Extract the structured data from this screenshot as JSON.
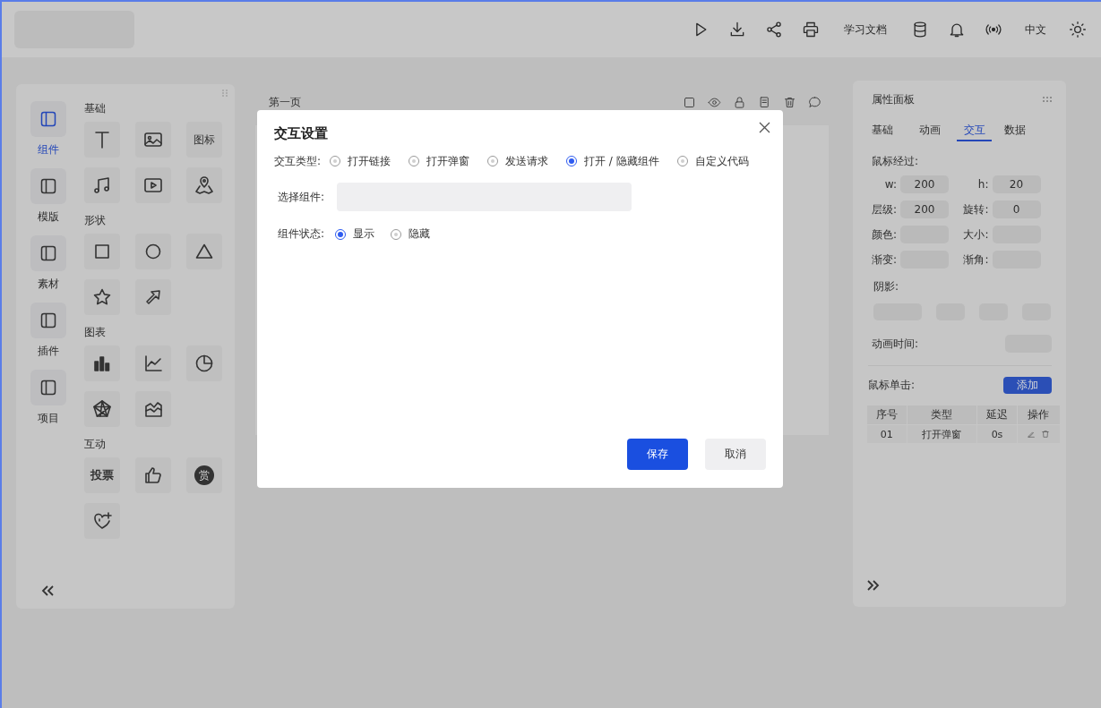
{
  "top_bar": {
    "docs_link": "学习文档",
    "language": "中文"
  },
  "left_nav": [
    {
      "label": "组件",
      "selected": true
    },
    {
      "label": "模版",
      "selected": false
    },
    {
      "label": "素材",
      "selected": false
    },
    {
      "label": "插件",
      "selected": false
    },
    {
      "label": "项目",
      "selected": false
    }
  ],
  "palette": [
    {
      "title": "基础",
      "tiles": [
        {
          "kind": "icon"
        },
        {
          "kind": "icon"
        },
        {
          "kind": "text",
          "label": "图标"
        },
        {
          "kind": "icon"
        },
        {
          "kind": "icon"
        },
        {
          "kind": "icon"
        }
      ]
    },
    {
      "title": "形状",
      "tiles": [
        {
          "kind": "icon"
        },
        {
          "kind": "icon"
        },
        {
          "kind": "icon"
        },
        {
          "kind": "icon"
        },
        {
          "kind": "icon"
        }
      ]
    },
    {
      "title": "图表",
      "tiles": [
        {
          "kind": "icon"
        },
        {
          "kind": "icon"
        },
        {
          "kind": "icon"
        },
        {
          "kind": "icon"
        },
        {
          "kind": "icon"
        }
      ]
    },
    {
      "title": "互动",
      "tiles": [
        {
          "kind": "text",
          "label": "投票"
        },
        {
          "kind": "icon"
        },
        {
          "kind": "seal",
          "label": "赏"
        },
        {
          "kind": "icon"
        }
      ]
    }
  ],
  "canvas": {
    "page_title": "第一页"
  },
  "properties_panel": {
    "title": "属性面板",
    "tabs": [
      {
        "label": "基础",
        "selected": false
      },
      {
        "label": "动画",
        "selected": false
      },
      {
        "label": "交互",
        "selected": true
      },
      {
        "label": "数据",
        "selected": false
      }
    ],
    "hover_label": "鼠标经过:",
    "fields": [
      {
        "label": "w:",
        "value": "200"
      },
      {
        "label": "h:",
        "value": "20"
      },
      {
        "label": "层级:",
        "value": "200"
      },
      {
        "label": "旋转:",
        "value": "0"
      },
      {
        "label": "颜色:"
      },
      {
        "label": "大小:"
      },
      {
        "label": "渐变:"
      },
      {
        "label": "渐角:"
      }
    ],
    "shadow_label": "阴影:",
    "duration_label": "动画时间:",
    "click_label": "鼠标单击:",
    "add_button": "添加",
    "table": {
      "columns": [
        "序号",
        "类型",
        "延迟",
        "操作"
      ],
      "rows": [
        [
          "01",
          "打开弹窗",
          "0s"
        ]
      ]
    }
  },
  "dialog": {
    "title": "交互设置",
    "interaction_type": {
      "label": "交互类型:",
      "options": [
        {
          "label": "打开链接",
          "selected": false
        },
        {
          "label": "打开弹窗",
          "selected": false
        },
        {
          "label": "发送请求",
          "selected": false
        },
        {
          "label": "打开 / 隐藏组件",
          "selected": true
        },
        {
          "label": "自定义代码",
          "selected": false
        }
      ]
    },
    "component_select": {
      "label": "选择组件:"
    },
    "component_state": {
      "label": "组件状态:",
      "options": [
        {
          "label": "显示",
          "selected": true
        },
        {
          "label": "隐藏",
          "selected": false
        }
      ]
    },
    "buttons": [
      {
        "label": "保存",
        "kind": "primary"
      },
      {
        "label": "取消",
        "kind": "secondary"
      }
    ]
  }
}
